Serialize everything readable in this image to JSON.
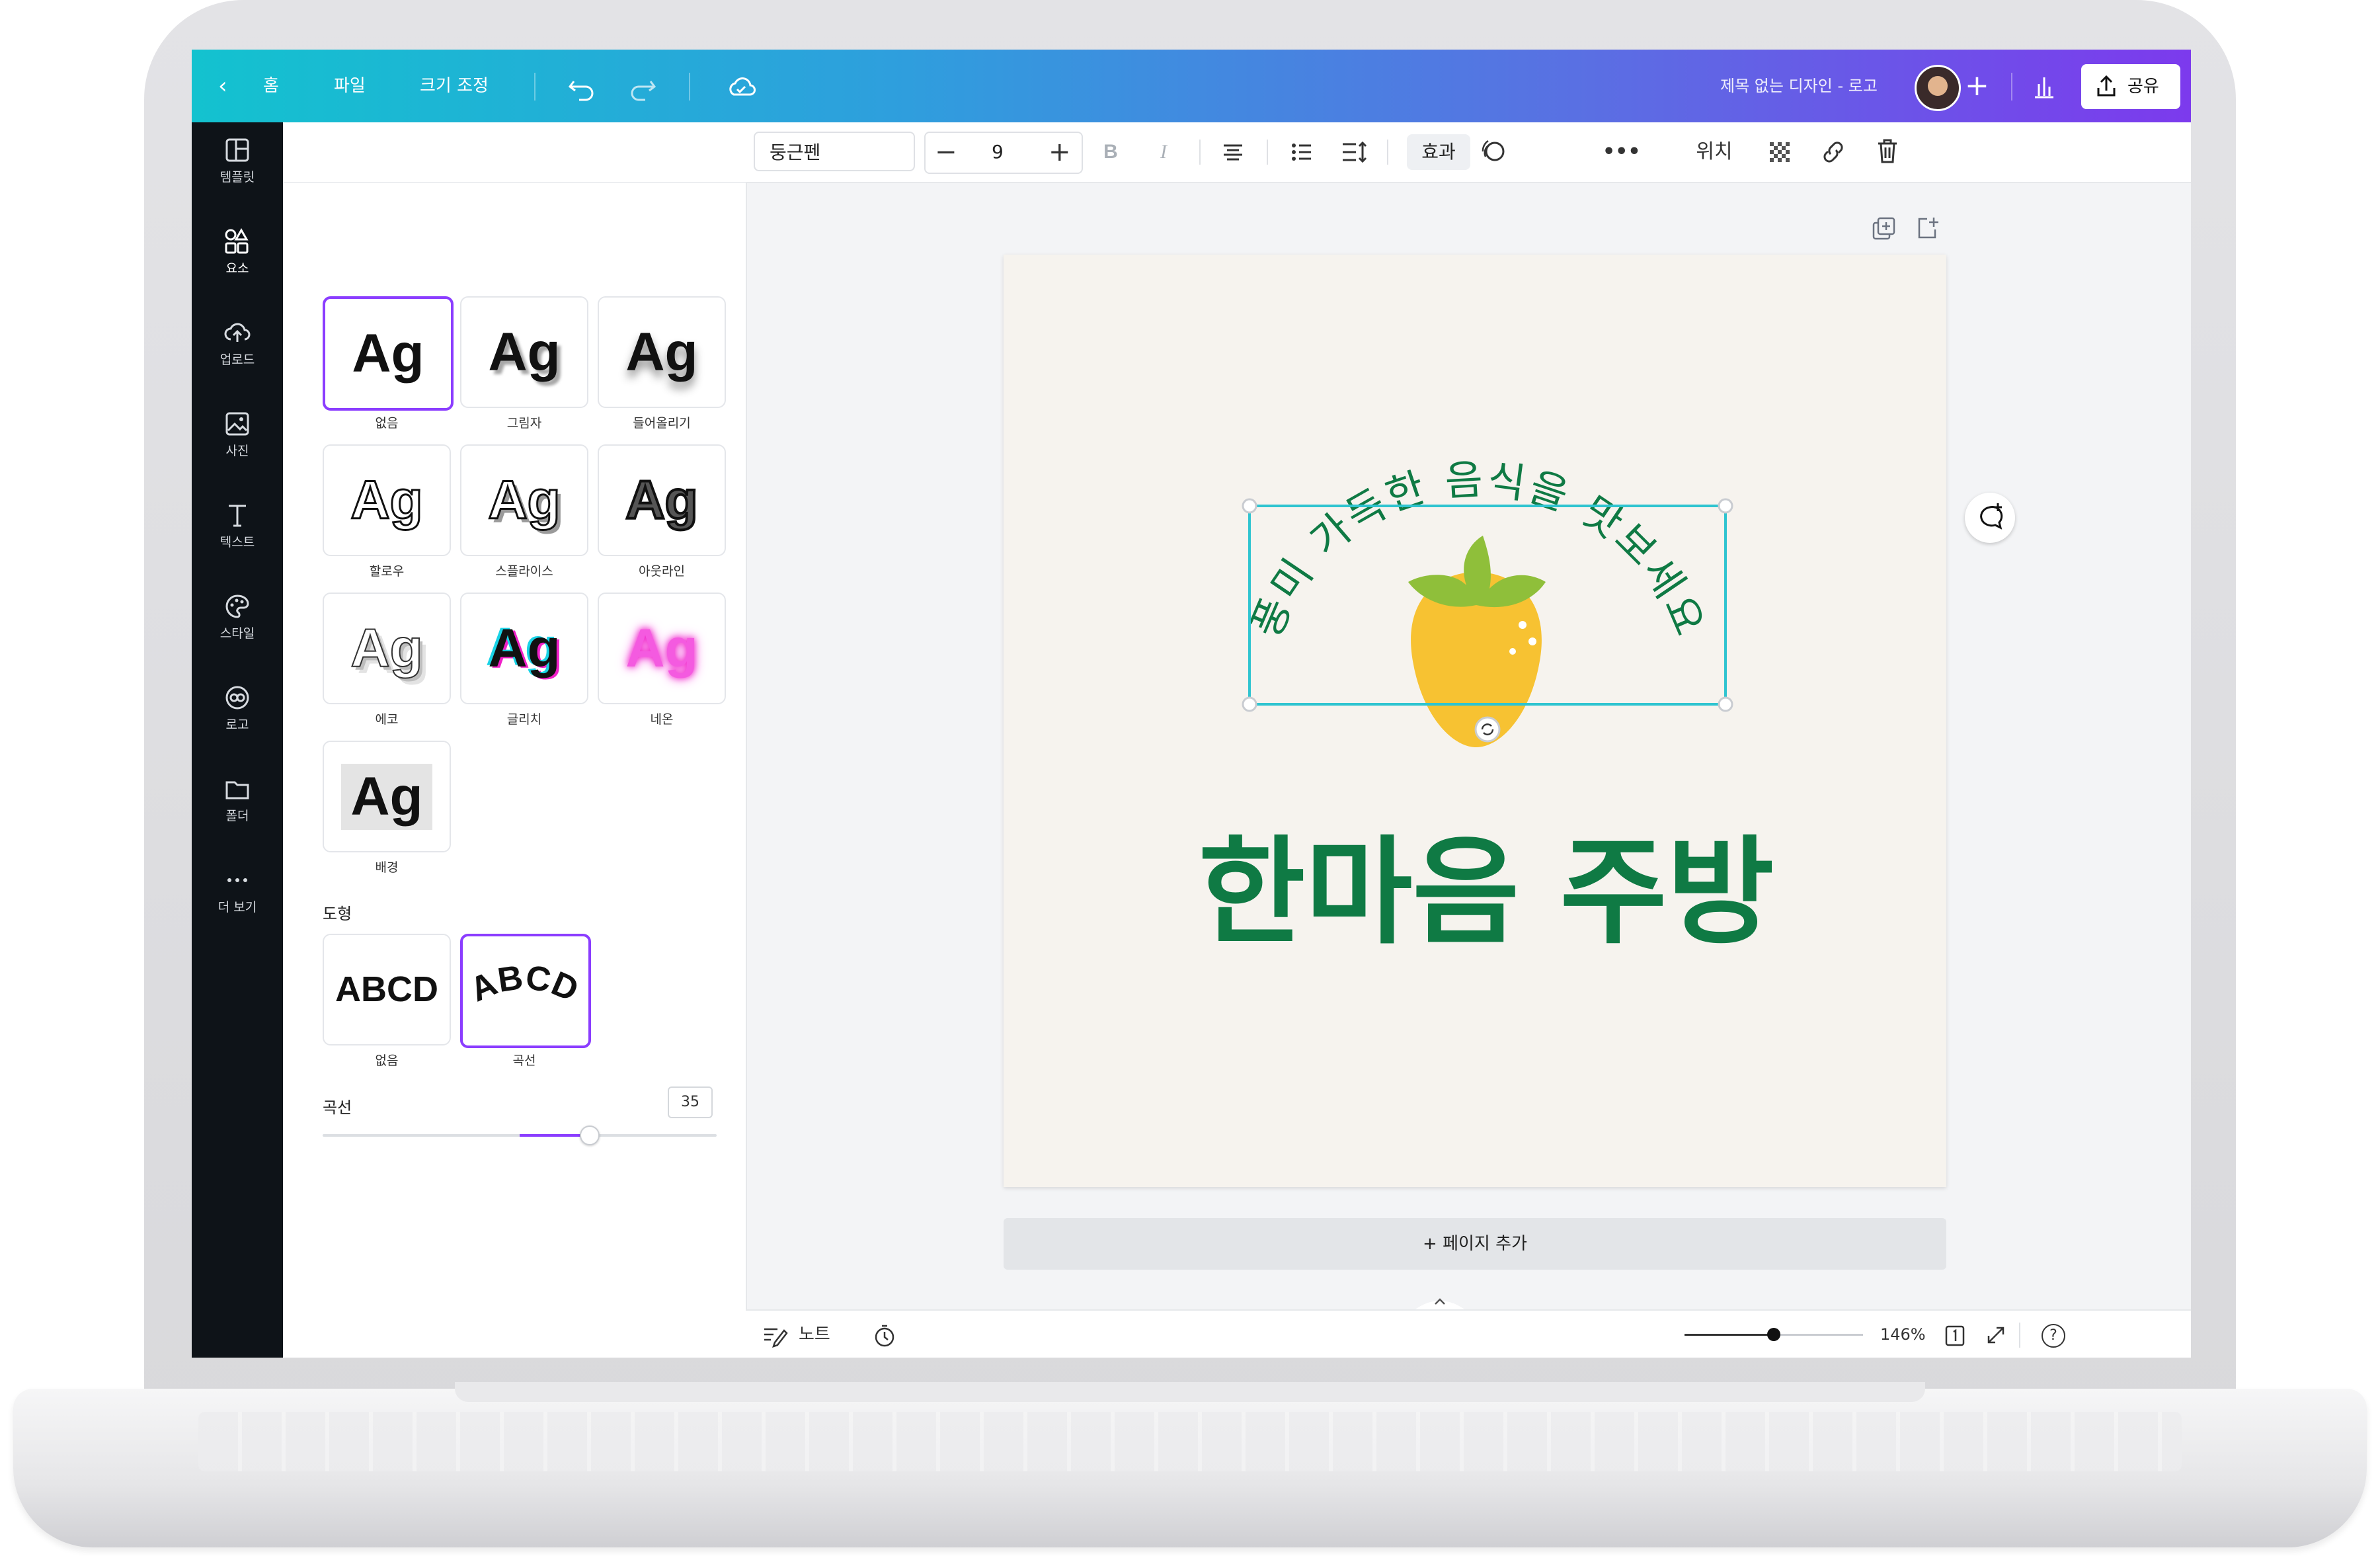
{
  "header": {
    "back_label": "홈",
    "file_label": "파일",
    "resize_label": "크기 조정",
    "doc_title": "제목 없는 디자인 - 로고",
    "share_label": "공유"
  },
  "rail": {
    "items": [
      {
        "icon": "template-icon",
        "label": "템플릿"
      },
      {
        "icon": "elements-icon",
        "label": "요소"
      },
      {
        "icon": "upload-icon",
        "label": "업로드"
      },
      {
        "icon": "photo-icon",
        "label": "사진"
      },
      {
        "icon": "text-icon",
        "label": "텍스트"
      },
      {
        "icon": "style-icon",
        "label": "스타일"
      },
      {
        "icon": "logo-icon",
        "label": "로고"
      },
      {
        "icon": "folder-icon",
        "label": "폴더"
      },
      {
        "icon": "more-icon",
        "label": "더 보기"
      }
    ]
  },
  "effects": {
    "sample": "Ag",
    "items": [
      "없음",
      "그림자",
      "들어올리기",
      "할로우",
      "스플라이스",
      "아웃라인",
      "에코",
      "글리치",
      "네온",
      "배경"
    ],
    "shape_section": "도형",
    "shape_sample": "ABCD",
    "shape_items": [
      "없음",
      "곡선"
    ],
    "curve_label": "곡선",
    "curve_value": "35",
    "curve_fraction": 0.35
  },
  "toolbar": {
    "font": "둥근펜",
    "size": "9",
    "bold": "B",
    "italic": "I",
    "effects_label": "효과",
    "position_label": "위치"
  },
  "design": {
    "arc_text": "풍미 가득한 음식을 맛보세요",
    "title": "한마음 주방"
  },
  "canvas": {
    "add_page": "+ 페이지 추가"
  },
  "bottom": {
    "notes_label": "노트",
    "zoom": "146%",
    "zoom_fraction": 0.5,
    "help": "?"
  },
  "colors": {
    "accent": "#8b3dff",
    "brand_green": "#0f7a44",
    "selection": "#2fc4d0",
    "strawberry": "#f7c232",
    "leaf": "#8fbf3a"
  }
}
